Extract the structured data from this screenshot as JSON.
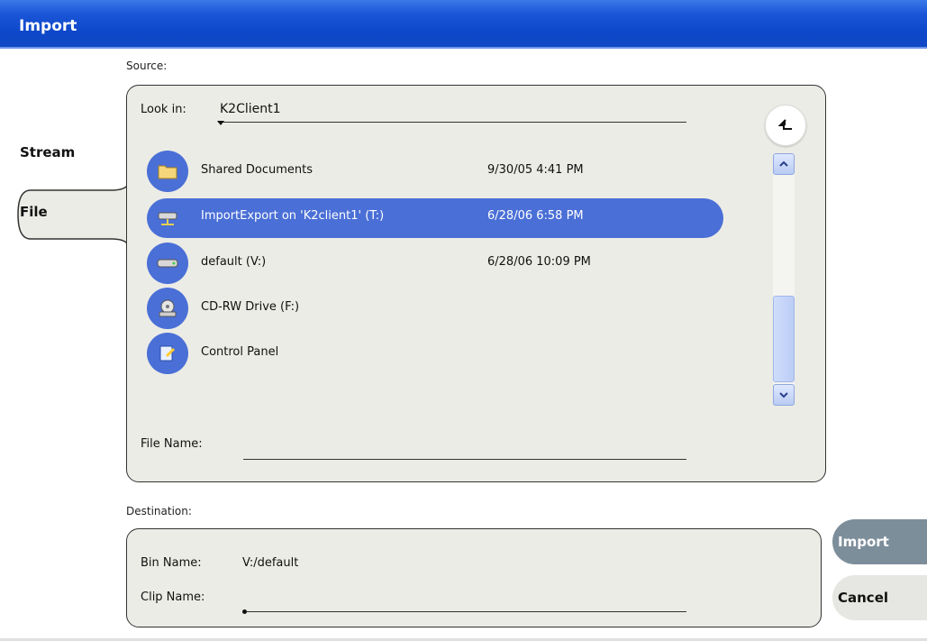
{
  "window": {
    "title": "Import"
  },
  "source": {
    "label": "Source:",
    "tabs": [
      {
        "label": "Stream"
      },
      {
        "label": "File"
      }
    ],
    "look_in": {
      "label": "Look in:",
      "value": "K2Client1"
    },
    "items": [
      {
        "name": "Shared Documents",
        "date": "9/30/05 4:41 PM",
        "icon": "folder-icon"
      },
      {
        "name": "ImportExport on 'K2client1' (T:)",
        "date": "6/28/06 6:58 PM",
        "icon": "network-drive-icon",
        "selected": true
      },
      {
        "name": "default (V:)",
        "date": "6/28/06 10:09 PM",
        "icon": "drive-icon"
      },
      {
        "name": "CD-RW Drive (F:)",
        "date": "",
        "icon": "cd-drive-icon"
      },
      {
        "name": "Control Panel",
        "date": "",
        "icon": "control-panel-icon"
      }
    ],
    "file_name": {
      "label": "File Name:",
      "value": ""
    }
  },
  "destination": {
    "label": "Destination:",
    "bin_name": {
      "label": "Bin Name:",
      "value": "V:/default"
    },
    "clip_name": {
      "label": "Clip Name:",
      "value": ""
    }
  },
  "buttons": {
    "import": "Import",
    "cancel": "Cancel"
  },
  "colors": {
    "titlebar": "#0d47c9",
    "selection": "#4a6fd6",
    "panel": "#ecece6",
    "import_button": "#7d8e9b"
  }
}
